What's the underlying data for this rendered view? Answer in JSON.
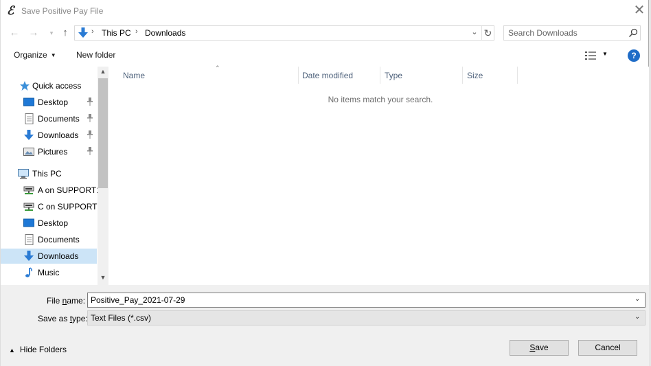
{
  "window": {
    "title": "Save Positive Pay File",
    "close_glyph": "✕"
  },
  "address_bar": {
    "crumbs": [
      "This PC",
      "Downloads"
    ],
    "search_placeholder": "Search Downloads"
  },
  "toolbar": {
    "organize_label": "Organize",
    "new_folder_label": "New folder"
  },
  "nav_pane": {
    "items": [
      {
        "label": "Quick access",
        "icon": "star-icon",
        "pinned": false,
        "selected": false
      },
      {
        "label": "Desktop",
        "icon": "desktop-icon",
        "pinned": true,
        "selected": false
      },
      {
        "label": "Documents",
        "icon": "documents-icon",
        "pinned": true,
        "selected": false
      },
      {
        "label": "Downloads",
        "icon": "downloads-icon",
        "pinned": true,
        "selected": false
      },
      {
        "label": "Pictures",
        "icon": "pictures-icon",
        "pinned": true,
        "selected": false
      },
      {
        "label": "This PC",
        "icon": "computer-icon",
        "pinned": false,
        "selected": false
      },
      {
        "label": "A on SUPPORT18",
        "icon": "network-drive-icon",
        "pinned": false,
        "selected": false
      },
      {
        "label": "C on SUPPORT18",
        "icon": "network-drive-icon",
        "pinned": false,
        "selected": false
      },
      {
        "label": "Desktop",
        "icon": "desktop-icon",
        "pinned": false,
        "selected": false
      },
      {
        "label": "Documents",
        "icon": "documents-icon",
        "pinned": false,
        "selected": false
      },
      {
        "label": "Downloads",
        "icon": "downloads-icon",
        "pinned": false,
        "selected": true
      },
      {
        "label": "Music",
        "icon": "music-icon",
        "pinned": false,
        "selected": false
      }
    ]
  },
  "file_list": {
    "columns": [
      "Name",
      "Date modified",
      "Type",
      "Size"
    ],
    "empty_message": "No items match your search."
  },
  "save_form": {
    "file_name_label_prefix": "File ",
    "file_name_label_accel": "n",
    "file_name_label_suffix": "ame:",
    "file_name_value": "Positive_Pay_2021-07-29",
    "save_type_label_prefix": "Save as ",
    "save_type_label_accel": "t",
    "save_type_label_suffix": "ype:",
    "save_type_value": "Text Files (*.csv)"
  },
  "footer": {
    "hide_folders_label": "Hide Folders",
    "save_accel": "S",
    "save_rest": "ave",
    "cancel_label": "Cancel"
  },
  "colors": {
    "accent_blue": "#1f6cc7",
    "selected_bg": "#cce4f7",
    "header_text": "#4c607a"
  }
}
